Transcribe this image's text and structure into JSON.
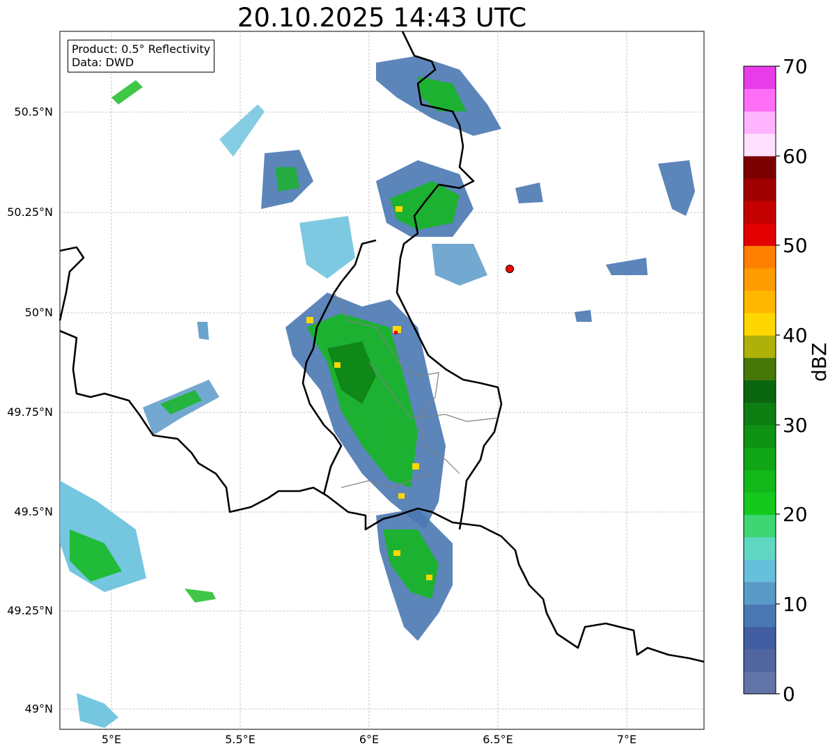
{
  "title": "20.10.2025 14:43 UTC",
  "legend": {
    "product": "Product: 0.5° Reflectivity",
    "source": "Data: DWD"
  },
  "axes": {
    "lat_ticks": [
      "50.5°N",
      "50.25°N",
      "50°N",
      "49.75°N",
      "49.5°N",
      "49.25°N",
      "49°N"
    ],
    "lon_ticks": [
      "5°E",
      "5.5°E",
      "6°E",
      "6.5°E",
      "7°E"
    ],
    "lon_range": [
      4.8,
      7.3
    ],
    "lat_range": [
      48.95,
      50.7
    ],
    "grid": "on, dashed gray"
  },
  "colorbar": {
    "label": "dBZ",
    "ticks": [
      "0",
      "10",
      "20",
      "30",
      "40",
      "50",
      "60",
      "70"
    ],
    "range": [
      0,
      70
    ],
    "colors": [
      "#6274a8",
      "#51659f",
      "#425ea2",
      "#4a78b3",
      "#5a9ac8",
      "#66c0dc",
      "#5fd7c3",
      "#3ed672",
      "#14c81e",
      "#12b81a",
      "#10a516",
      "#0f9114",
      "#0d7e12",
      "#0a6710",
      "#457709",
      "#afb10b",
      "#ffd700",
      "#ffb700",
      "#ff9c00",
      "#ff8000",
      "#e30000",
      "#c40000",
      "#a10000",
      "#7c0000",
      "#ffe0ff",
      "#ffb4ff",
      "#ff6ef7",
      "#e93ce9"
    ]
  },
  "radar_marker": {
    "lon": 6.55,
    "lat": 50.11,
    "color": "#ff0000"
  },
  "echo_palette": {
    "light": "#4a78b3",
    "mid": "#66c0dc",
    "strong": "#12b81a",
    "heavy": "#ffd700"
  }
}
